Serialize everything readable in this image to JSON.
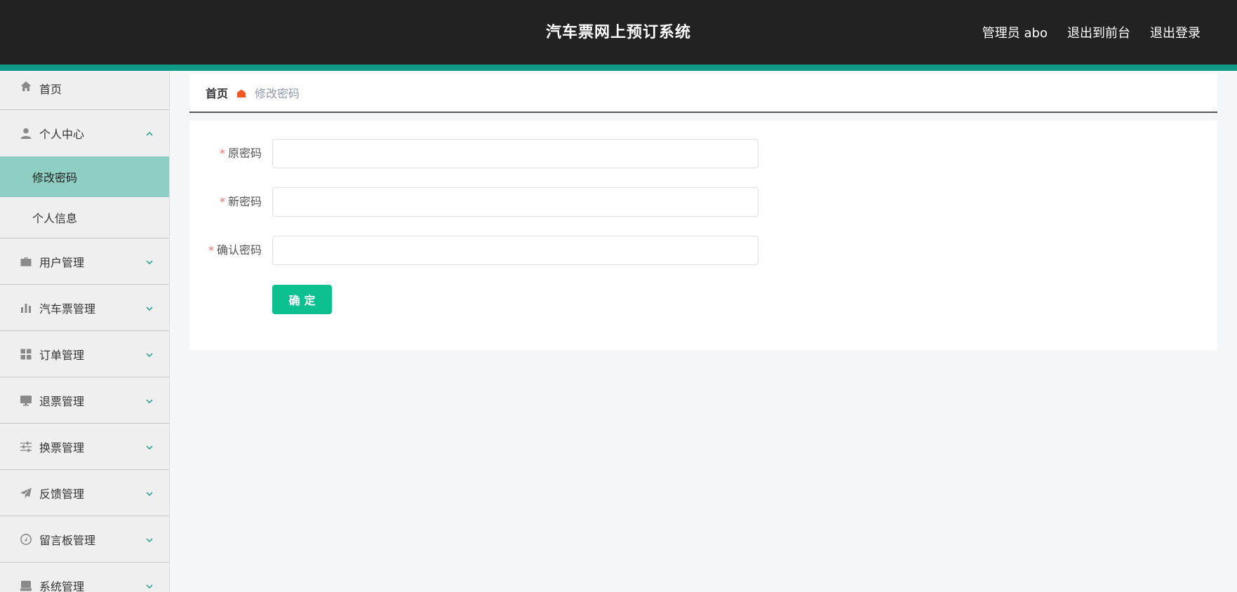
{
  "header": {
    "title": "汽车票网上预订系统",
    "admin_label": "管理员 abo",
    "to_front_label": "退出到前台",
    "logout_label": "退出登录",
    "bar_color": "#222222",
    "accent_color": "#0e9a86"
  },
  "sidebar": {
    "items": [
      {
        "label": "首页",
        "icon": "home-icon"
      },
      {
        "label": "个人中心",
        "icon": "user-icon",
        "expanded": true,
        "children": [
          {
            "label": "修改密码",
            "active": true
          },
          {
            "label": "个人信息"
          }
        ]
      },
      {
        "label": "用户管理",
        "icon": "briefcase-icon"
      },
      {
        "label": "汽车票管理",
        "icon": "bar-chart-icon"
      },
      {
        "label": "订单管理",
        "icon": "grid-icon"
      },
      {
        "label": "退票管理",
        "icon": "monitor-icon"
      },
      {
        "label": "换票管理",
        "icon": "sliders-icon"
      },
      {
        "label": "反馈管理",
        "icon": "paper-plane-icon"
      },
      {
        "label": "留言板管理",
        "icon": "gauge-icon"
      },
      {
        "label": "系统管理",
        "icon": "drive-icon"
      }
    ],
    "active_color": "#8fcfc3"
  },
  "breadcrumb": {
    "home": "首页",
    "current": "修改密码",
    "separator_icon": "house-icon"
  },
  "form": {
    "required_mark": "*",
    "fields": [
      {
        "label": "原密码",
        "value": "",
        "placeholder": ""
      },
      {
        "label": "新密码",
        "value": "",
        "placeholder": ""
      },
      {
        "label": "确认密码",
        "value": "",
        "placeholder": ""
      }
    ],
    "submit_label": "确定",
    "submit_color": "#0dc08f"
  }
}
